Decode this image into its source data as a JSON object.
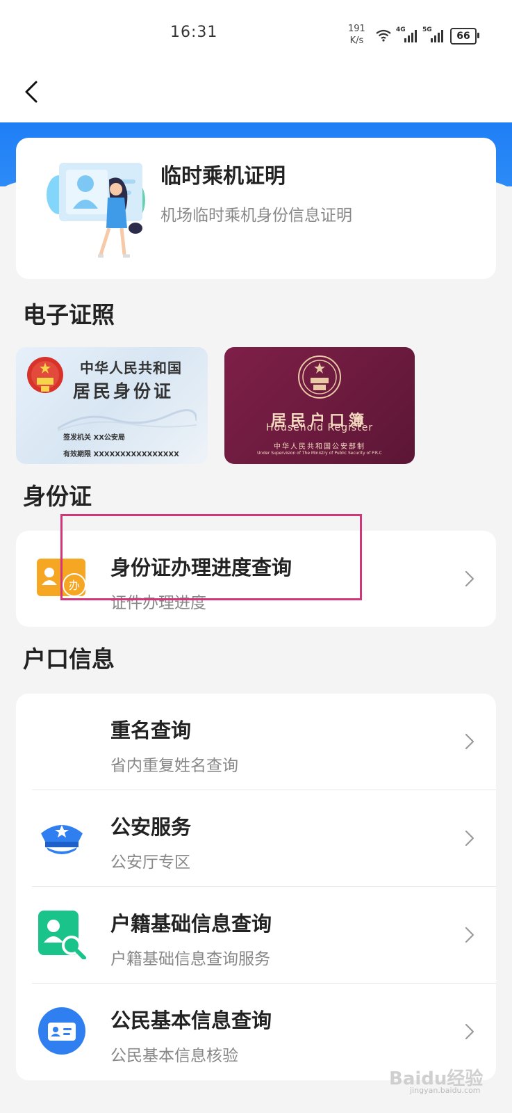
{
  "status_bar": {
    "time": "16:31",
    "net_speed_value": "191",
    "net_speed_unit": "K/s",
    "network_4g": "4G",
    "network_5g": "5G",
    "battery": "66"
  },
  "colors": {
    "accent_blue": "#1f7ef5",
    "highlight_box": "#d0367a",
    "passport_maroon": "#7e1f48",
    "icon_orange": "#f5a623",
    "icon_green": "#19c38a"
  },
  "promo_card": {
    "title": "临时乘机证明",
    "subtitle": "机场临时乘机身份信息证明"
  },
  "e_license": {
    "section_title": "电子证照",
    "id_card": {
      "line1": "中华人民共和国",
      "line2": "居民身份证",
      "issuer": "签发机关  XX公安局",
      "validity": "有效期限  XXXXXXXXXXXXXXXX"
    },
    "household_register": {
      "title_cn": "居民户口簿",
      "title_en": "Household  Register",
      "issuer_cn": "中华人民共和国公安部制",
      "issuer_en": "Under Supervision of The Ministry of Public Security of P.R.C"
    }
  },
  "id_section": {
    "section_title": "身份证",
    "items": [
      {
        "title": "身份证办理进度查询",
        "subtitle": "证件办理进度",
        "icon": "id-progress-icon"
      }
    ]
  },
  "hukou_section": {
    "section_title": "户口信息",
    "items": [
      {
        "title": "重名查询",
        "subtitle": "省内重复姓名查询",
        "icon": "none"
      },
      {
        "title": "公安服务",
        "subtitle": "公安厅专区",
        "icon": "police-cap-icon"
      },
      {
        "title": "户籍基础信息查询",
        "subtitle": "户籍基础信息查询服务",
        "icon": "person-search-icon"
      },
      {
        "title": "公民基本信息查询",
        "subtitle": "公民基本信息核验",
        "icon": "id-card-icon"
      }
    ]
  },
  "watermark": {
    "text": "Baidu经验",
    "sub": "jingyan.baidu.com"
  }
}
